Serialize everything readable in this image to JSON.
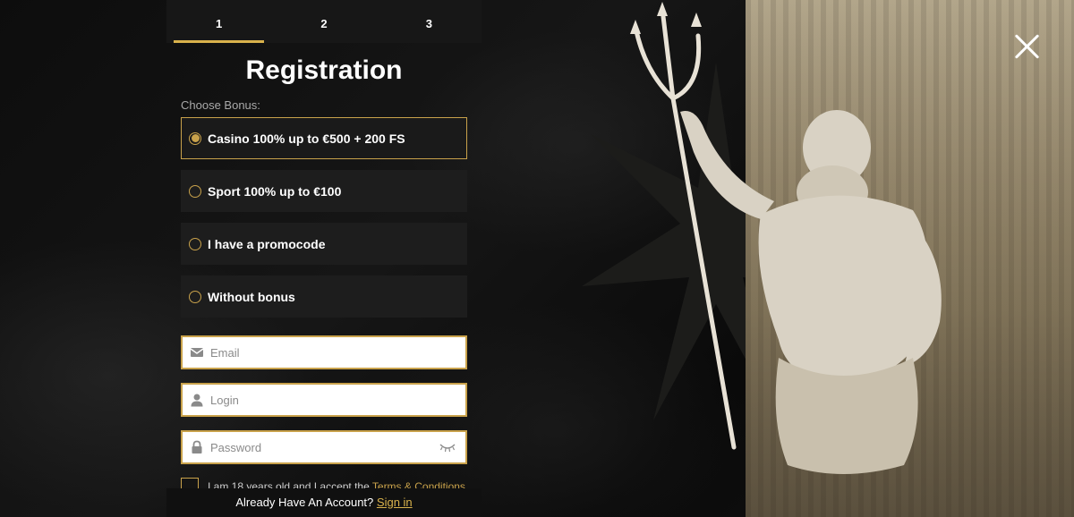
{
  "steps": [
    {
      "label": "1",
      "active": true
    },
    {
      "label": "2",
      "active": false
    },
    {
      "label": "3",
      "active": false
    }
  ],
  "form": {
    "title": "Registration",
    "choose_bonus_label": "Choose Bonus:",
    "bonus_options": [
      {
        "label": "Casino 100% up to €500 + 200 FS",
        "selected": true
      },
      {
        "label": "Sport 100% up to €100",
        "selected": false
      },
      {
        "label": "I have a promocode",
        "selected": false
      },
      {
        "label": "Without bonus",
        "selected": false
      }
    ],
    "email": {
      "placeholder": "Email",
      "value": "",
      "icon": "envelope-icon"
    },
    "login": {
      "placeholder": "Login",
      "value": "",
      "icon": "user-icon"
    },
    "password": {
      "placeholder": "Password",
      "value": "",
      "icon": "lock-icon",
      "toggle_icon": "eye-closed-icon"
    },
    "terms": {
      "text": "I am 18 years old and I accept the ",
      "link": "Terms & Conditions"
    }
  },
  "footer": {
    "text": "Already Have An Account?",
    "signin_link": "Sign in"
  },
  "colors": {
    "accent": "#c9a24b",
    "background": "#0b0b0b",
    "panel": "#1d1d1d"
  }
}
